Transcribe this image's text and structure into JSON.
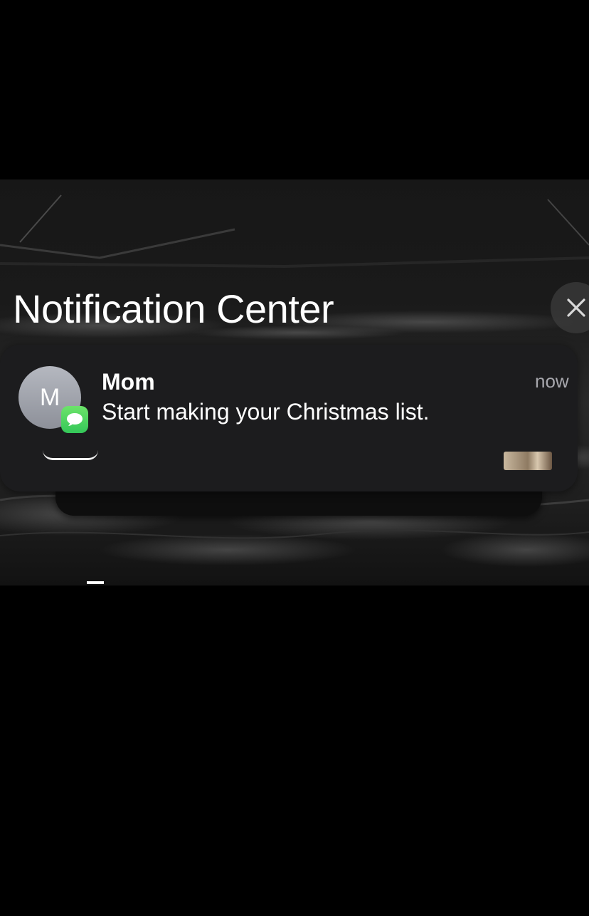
{
  "notification_center": {
    "title": "Notification Center",
    "close_icon": "close-x-icon"
  },
  "notification": {
    "app_icon": "messages-bubble-icon",
    "avatar_initial": "M",
    "sender": "Mom",
    "message": "Start making your Christmas list.",
    "timestamp": "now"
  },
  "colors": {
    "background": "#000000",
    "card": "#1c1c1e",
    "messages_green": "#34c759",
    "text_primary": "#ffffff",
    "text_secondary": "#a7a7ad"
  }
}
